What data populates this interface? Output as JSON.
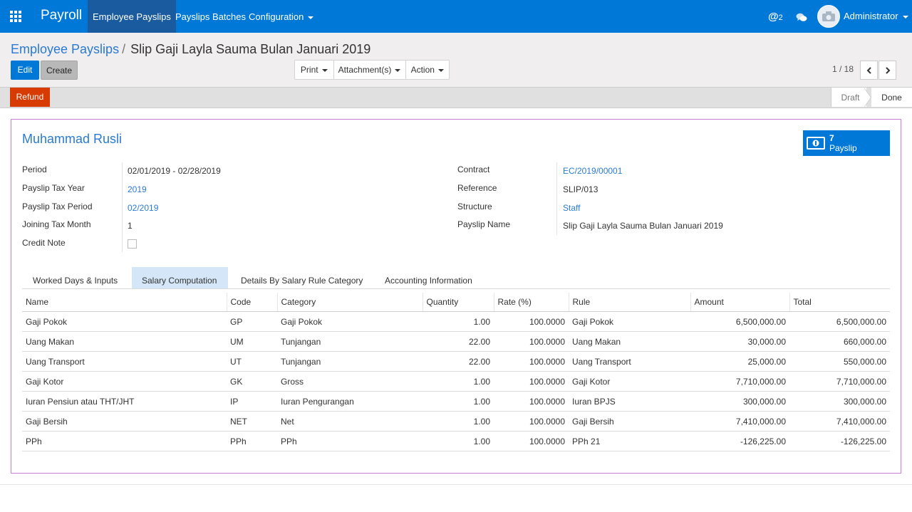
{
  "topbar": {
    "brand": "Payroll",
    "menus": [
      {
        "label": "Employee Payslips"
      },
      {
        "label": "Payslips Batches"
      },
      {
        "label": "Configuration"
      }
    ],
    "mention_count": "2",
    "user": "Administrator"
  },
  "breadcrumb": {
    "parent": "Employee Payslips",
    "separator": "/",
    "current": "Slip Gaji Layla Sauma Bulan Januari 2019"
  },
  "toolbar": {
    "edit": "Edit",
    "create": "Create",
    "print": "Print",
    "attachments": "Attachment(s)",
    "action": "Action"
  },
  "pager": {
    "value": "1 / 18"
  },
  "status": {
    "refund": "Refund",
    "stages": [
      "Draft",
      "Done"
    ],
    "current_stage": "Done"
  },
  "form": {
    "employee": "Muhammad Rusli",
    "smart_button": {
      "count": "7",
      "label": "Payslip",
      "icon": "money-icon"
    },
    "left": [
      {
        "label": "Period",
        "value": "02/01/2019 - 02/28/2019"
      },
      {
        "label": "Payslip Tax Year",
        "value": "2019"
      },
      {
        "label": "Payslip Tax Period",
        "value": "02/2019"
      },
      {
        "label": "Joining Tax Month",
        "value": "1"
      },
      {
        "label": "Credit Note",
        "value": ""
      }
    ],
    "right": [
      {
        "label": "Contract",
        "value": "EC/2019/00001"
      },
      {
        "label": "Reference",
        "value": "SLIP/013"
      },
      {
        "label": "Structure",
        "value": "Staff"
      },
      {
        "label": "Payslip Name",
        "value": "Slip Gaji Layla Sauma Bulan Januari 2019"
      }
    ]
  },
  "tabs": [
    {
      "label": "Worked Days & Inputs"
    },
    {
      "label": "Salary Computation"
    },
    {
      "label": "Details By Salary Rule Category"
    },
    {
      "label": "Accounting Information"
    }
  ],
  "active_tab": "Salary Computation",
  "lines": {
    "headers": [
      "Name",
      "Code",
      "Category",
      "Quantity",
      "Rate (%)",
      "Rule",
      "Amount",
      "Total"
    ],
    "rows": [
      [
        "Gaji Pokok",
        "GP",
        "Gaji Pokok",
        "1.00",
        "100.0000",
        "Gaji Pokok",
        "6,500,000.00",
        "6,500,000.00"
      ],
      [
        "Uang Makan",
        "UM",
        "Tunjangan",
        "22.00",
        "100.0000",
        "Uang Makan",
        "30,000.00",
        "660,000.00"
      ],
      [
        "Uang Transport",
        "UT",
        "Tunjangan",
        "22.00",
        "100.0000",
        "Uang Transport",
        "25,000.00",
        "550,000.00"
      ],
      [
        "Gaji Kotor",
        "GK",
        "Gross",
        "1.00",
        "100.0000",
        "Gaji Kotor",
        "7,710,000.00",
        "7,710,000.00"
      ],
      [
        "Iuran Pensiun atau THT/JHT",
        "IP",
        "Iuran Pengurangan",
        "1.00",
        "100.0000",
        "Iuran BPJS",
        "300,000.00",
        "300,000.00"
      ],
      [
        "Gaji Bersih",
        "NET",
        "Net",
        "1.00",
        "100.0000",
        "Gaji Bersih",
        "7,410,000.00",
        "7,410,000.00"
      ],
      [
        "PPh",
        "PPh",
        "PPh",
        "1.00",
        "100.0000",
        "PPh 21",
        "-126,225.00",
        "-126,225.00"
      ]
    ]
  },
  "colors": {
    "primary": "#0078d7",
    "refund": "#d83b01",
    "link": "#2a7ad3",
    "sheet_border": "#c97bd6"
  }
}
